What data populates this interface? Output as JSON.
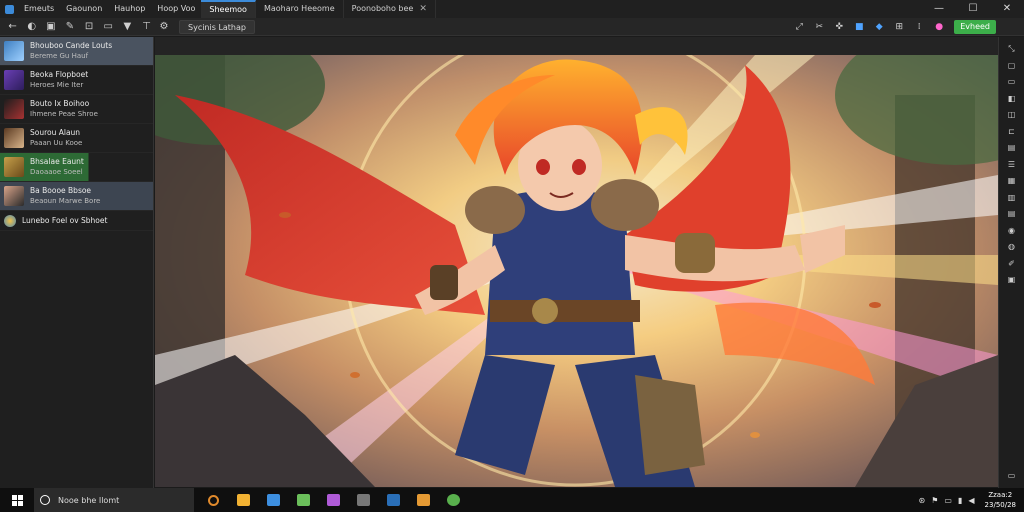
{
  "titlebar": {
    "menu": [
      "Emeuts",
      "Gaounon",
      "Hauhop",
      "Hoop Voo"
    ],
    "tabs": [
      {
        "label": "Sheemoo",
        "active": true
      },
      {
        "label": "Maoharo Heeome",
        "active": false
      },
      {
        "label": "Poonoboho bee",
        "active": false,
        "closable": true
      }
    ],
    "controls": {
      "minimize": "—",
      "maximize": "☐",
      "close": "✕"
    }
  },
  "toolbar": {
    "document_title": "Sycinis Lathap",
    "primary_button": "Evheed",
    "left_icons": [
      "back-icon",
      "refresh-icon",
      "home-icon",
      "brush-icon",
      "stamp-icon",
      "layout-icon",
      "bookmark-icon",
      "filter-icon"
    ],
    "right_icons": [
      "expand-icon",
      "crop-icon",
      "tools-icon",
      "cut-icon",
      "layers-icon",
      "share-icon",
      "grid-icon",
      "palette-icon"
    ]
  },
  "sidebar": {
    "items": [
      {
        "title": "Bhouboo Cande Louts",
        "subtitle": "Bereme Gu Hauf",
        "thumb": "#3e7fc2",
        "state": "active"
      },
      {
        "title": "Beoka Flopboet",
        "subtitle": "Heroes Mie Iter",
        "thumb": "#6a3fb5",
        "state": ""
      },
      {
        "title": "Bouto Ix Boihoo",
        "subtitle": "Ihmene Peae Shroe",
        "thumb": "#7a2a2a",
        "state": ""
      },
      {
        "title": "Sourou Alaun",
        "subtitle": "Paaan Uu Kooe",
        "thumb": "#5b3a22",
        "state": ""
      },
      {
        "title": "Bhsalae Eaunt",
        "subtitle": "Daoaaoe Soeel",
        "thumb": "#c6a04a",
        "state": "highlight"
      },
      {
        "title": "Ba Boooe Bbsoe",
        "subtitle": "Beaoun Marwe Bore",
        "thumb": "#d9a48a",
        "state": "selected"
      },
      {
        "title": "Lunebo Foel ov Sbhoet",
        "subtitle": "",
        "thumb": "#4f8ab3",
        "state": ""
      }
    ]
  },
  "canvas": {
    "scene": "Anime hero with flowing red cape in a sunlit forest with light rays"
  },
  "rail": {
    "icons": [
      "collapse-icon",
      "panel-icon",
      "frame-icon",
      "layers-icon",
      "camera-icon",
      "crop-icon",
      "chat-icon",
      "list-icon",
      "table-icon",
      "grid-icon",
      "text-icon",
      "toggle-icon",
      "edit-icon",
      "brush-icon",
      "settings-icon",
      "panel-bottom-icon"
    ]
  },
  "taskbar": {
    "search_placeholder": "Nooe bhe Ilomt",
    "apps": [
      "#e08a2c",
      "#f2b233",
      "#3d8fe0",
      "#6bbf5b",
      "#b05bd8",
      "#777777",
      "#2a6fb8",
      "#e59a34",
      "#59b04d"
    ],
    "clock_time": "Zzaa:2",
    "clock_date": "23/50/28"
  },
  "colors": {
    "accent": "#3c8bd9",
    "primary_button": "#3cae4a",
    "sidebar_active": "#4a5360"
  }
}
